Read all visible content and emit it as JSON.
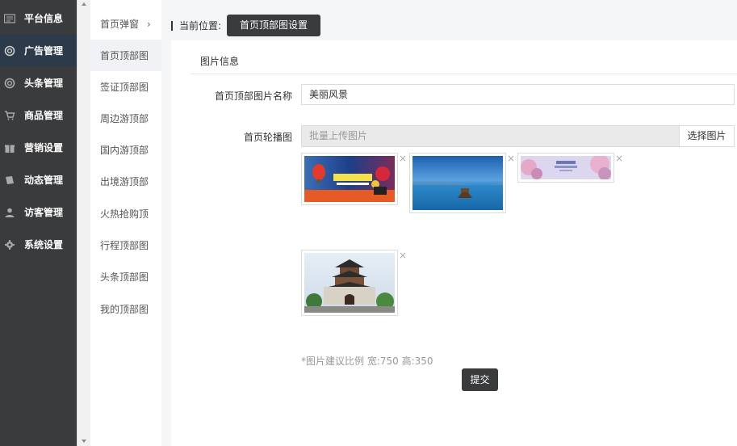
{
  "sidebar": {
    "items": [
      {
        "label": "平台信息",
        "icon": "id-card-icon"
      },
      {
        "label": "广告管理",
        "icon": "lifebuoy-icon"
      },
      {
        "label": "头条管理",
        "icon": "lifebuoy-icon"
      },
      {
        "label": "商品管理",
        "icon": "cart-icon"
      },
      {
        "label": "营销设置",
        "icon": "gift-icon"
      },
      {
        "label": "动态管理",
        "icon": "book-icon"
      },
      {
        "label": "访客管理",
        "icon": "user-icon"
      },
      {
        "label": "系统设置",
        "icon": "gear-icon"
      }
    ],
    "active_index": 1
  },
  "submenu": {
    "items": [
      {
        "label": "首页弹窗",
        "chevron": "›"
      },
      {
        "label": "首页顶部图"
      },
      {
        "label": "签证顶部图"
      },
      {
        "label": "周边游顶部"
      },
      {
        "label": "国内游顶部"
      },
      {
        "label": "出境游顶部"
      },
      {
        "label": "火热抢购顶"
      },
      {
        "label": "行程顶部图"
      },
      {
        "label": "头条顶部图"
      },
      {
        "label": "我的顶部图"
      }
    ],
    "active_index": 1
  },
  "breadcrumb": {
    "label": "当前位置:",
    "current": "首页顶部图设置"
  },
  "panel": {
    "title": "图片信息",
    "name_label": "首页顶部图片名称",
    "name_value": "美丽风景",
    "carousel_label": "首页轮播图",
    "upload_placeholder": "批量上传图片",
    "upload_button": "选择图片",
    "close_glyph": "×",
    "hint": "*图片建议比例 宽:750 高:350",
    "submit": "提交"
  },
  "colors": {
    "sidebar_bg": "#3a3b3d",
    "sidebar_active": "#2c3a4a",
    "button_dark": "#3a3b3d"
  }
}
